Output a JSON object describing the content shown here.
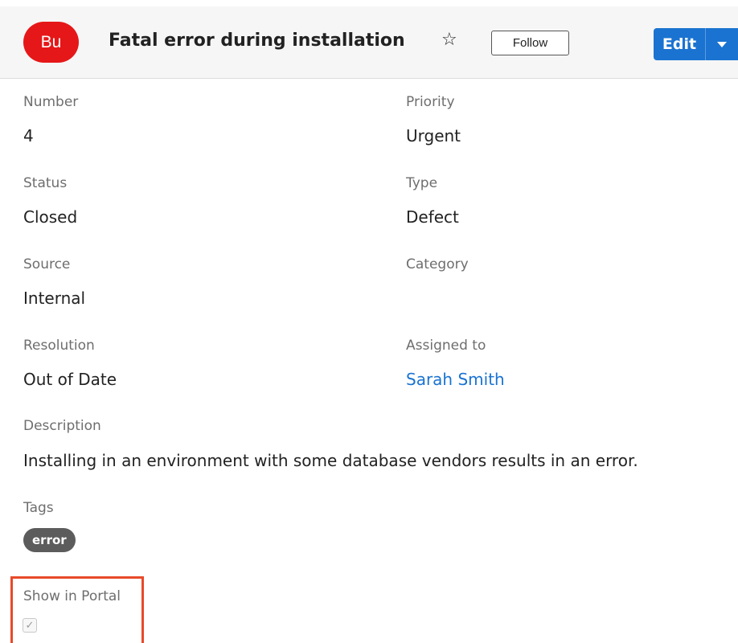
{
  "header": {
    "avatar_text": "Bu",
    "title": "Fatal error during installation",
    "favorite_icon": "☆",
    "follow_label": "Follow",
    "edit_label": "Edit"
  },
  "fields": {
    "number": {
      "label": "Number",
      "value": "4"
    },
    "priority": {
      "label": "Priority",
      "value": "Urgent"
    },
    "status": {
      "label": "Status",
      "value": "Closed"
    },
    "type": {
      "label": "Type",
      "value": "Defect"
    },
    "source": {
      "label": "Source",
      "value": "Internal"
    },
    "category": {
      "label": "Category",
      "value": ""
    },
    "resolution": {
      "label": "Resolution",
      "value": "Out of Date"
    },
    "assigned_to": {
      "label": "Assigned to",
      "value": "Sarah Smith"
    },
    "description": {
      "label": "Description",
      "value": "Installing in an environment with some database vendors results in an error."
    },
    "tags": {
      "label": "Tags",
      "items": [
        "error"
      ]
    },
    "show_in_portal": {
      "label": "Show in Portal",
      "checked": true,
      "check_glyph": "✓"
    }
  },
  "colors": {
    "avatar": "#e61718",
    "primary": "#1a73d1",
    "highlight": "#e84a2a",
    "tag": "#5c5c5c"
  }
}
